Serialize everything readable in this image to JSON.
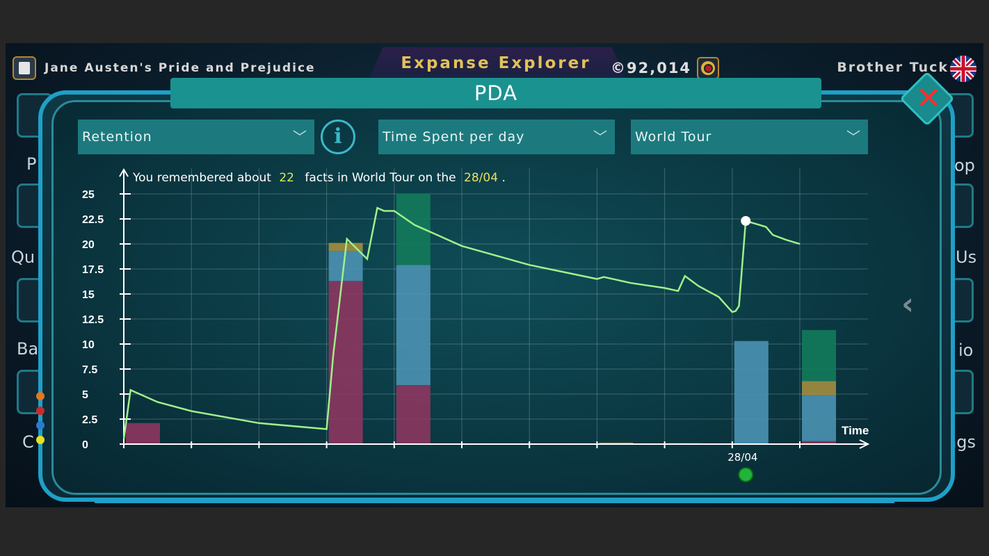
{
  "topbar": {
    "book_title": "Jane Austen's Pride and Prejudice",
    "app_title": "Expanse Explorer",
    "coins": "©92,014",
    "username": "Brother Tuck"
  },
  "side_labels": {
    "left": [
      "P",
      "Qu",
      "Ba",
      "C"
    ],
    "right": [
      "op",
      "Us",
      "io",
      "ngs"
    ]
  },
  "modal": {
    "title": "PDA",
    "dropdowns": [
      {
        "label": "Retention"
      },
      {
        "label": "Time Spent per day"
      },
      {
        "label": "World Tour"
      }
    ],
    "info_label": "i",
    "summary": {
      "prefix": "You remembered about",
      "count": "22",
      "middle": "facts in World Tour on the",
      "date": "28/04",
      "suffix": "."
    }
  },
  "colors": {
    "retention_line": "#9ff08a",
    "bar_pink": "#8a3660",
    "bar_blue": "#4a90b0",
    "bar_green": "#127a5a",
    "bar_gold": "#a08c40",
    "accent": "#1ea0c8"
  },
  "chart_data": {
    "type": "bar",
    "xlabel": "Time",
    "ylabel": "",
    "ylim": [
      0,
      25
    ],
    "yticks": [
      "0",
      "2.5",
      "5",
      "7.5",
      "10",
      "12.5",
      "15",
      "17.5",
      "20",
      "22.5",
      "25"
    ],
    "x_tick_labels": [
      {
        "index": 9,
        "label": "28/04"
      }
    ],
    "grid": true,
    "bars": [
      {
        "slot": 0,
        "segments": [
          {
            "color": "pink",
            "value": 2.1
          }
        ]
      },
      {
        "slot": 3,
        "segments": [
          {
            "color": "pink",
            "value": 16.3
          },
          {
            "color": "blue",
            "value": 3.0
          },
          {
            "color": "gold",
            "value": 0.8
          }
        ]
      },
      {
        "slot": 4,
        "segments": [
          {
            "color": "pink",
            "value": 5.9
          },
          {
            "color": "blue",
            "value": 12.0
          },
          {
            "color": "green",
            "value": 7.1
          }
        ]
      },
      {
        "slot": 7,
        "segments": [
          {
            "color": "gold",
            "value": 0.15
          }
        ]
      },
      {
        "slot": 8,
        "segments": [
          {
            "color": "green",
            "value": 0.1
          }
        ]
      },
      {
        "slot": 9,
        "segments": [
          {
            "color": "blue",
            "value": 10.3
          }
        ]
      },
      {
        "slot": 10,
        "segments": [
          {
            "color": "pink",
            "value": 0.3
          },
          {
            "color": "blue",
            "value": 4.6
          },
          {
            "color": "gold",
            "value": 1.4
          },
          {
            "color": "green",
            "value": 5.1
          }
        ]
      }
    ],
    "retention_series": {
      "x": [
        0,
        0.1,
        0.5,
        1,
        2,
        3,
        3.1,
        3.3,
        3.6,
        3.75,
        3.85,
        4,
        4.3,
        5,
        6,
        7,
        7.1,
        7.5,
        8,
        8.2,
        8.3,
        8.5,
        8.8,
        9,
        9.05,
        9.1,
        9.2,
        9.4,
        9.5,
        9.6,
        9.8,
        10
      ],
      "y": [
        0.5,
        5.4,
        4.2,
        3.3,
        2.1,
        1.5,
        9,
        20.5,
        18.5,
        23.6,
        23.3,
        23.3,
        21.9,
        19.8,
        17.9,
        16.5,
        16.7,
        16.1,
        15.6,
        15.3,
        16.8,
        15.8,
        14.7,
        13.2,
        13.3,
        13.8,
        22.3,
        21.9,
        21.7,
        20.9,
        20.4,
        20.0
      ]
    },
    "highlight_point": {
      "x": 9.2,
      "y": 22.3
    },
    "selected_date_marker": {
      "x": 9.2
    }
  }
}
